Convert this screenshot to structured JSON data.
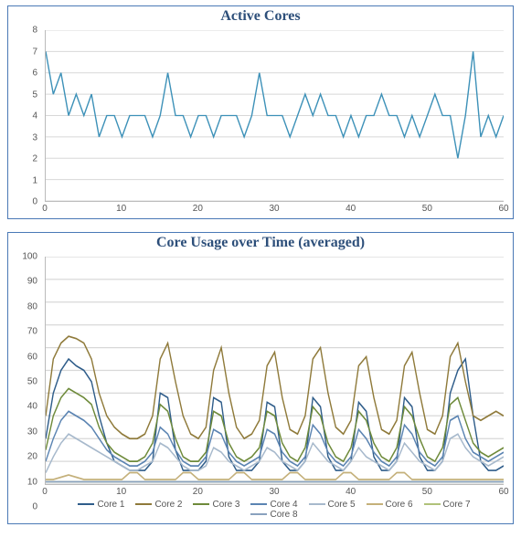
{
  "chart_data": [
    {
      "type": "line",
      "title": "Active Cores",
      "xlabel": "",
      "ylabel": "",
      "xlim": [
        0,
        60
      ],
      "ylim": [
        0,
        8
      ],
      "xticks": [
        0,
        10,
        20,
        30,
        40,
        50,
        60
      ],
      "yticks": [
        0,
        1,
        2,
        3,
        4,
        5,
        6,
        7,
        8
      ],
      "series": [
        {
          "name": "Active Cores",
          "color": "#3d91b8",
          "x": [
            0,
            1,
            2,
            3,
            4,
            5,
            6,
            7,
            8,
            9,
            10,
            11,
            12,
            13,
            14,
            15,
            16,
            17,
            18,
            19,
            20,
            21,
            22,
            23,
            24,
            25,
            26,
            27,
            28,
            29,
            30,
            31,
            32,
            33,
            34,
            35,
            36,
            37,
            38,
            39,
            40,
            41,
            42,
            43,
            44,
            45,
            46,
            47,
            48,
            49,
            50,
            51,
            52,
            53,
            54,
            55,
            56,
            57,
            58,
            59,
            60
          ],
          "values": [
            7,
            5,
            6,
            4,
            5,
            4,
            5,
            3,
            4,
            4,
            3,
            4,
            4,
            4,
            3,
            4,
            6,
            4,
            4,
            3,
            4,
            4,
            3,
            4,
            4,
            4,
            3,
            4,
            6,
            4,
            4,
            4,
            3,
            4,
            5,
            4,
            5,
            4,
            4,
            3,
            4,
            3,
            4,
            4,
            5,
            4,
            4,
            3,
            4,
            3,
            4,
            5,
            4,
            4,
            2,
            4,
            7,
            3,
            4,
            3,
            4
          ]
        }
      ]
    },
    {
      "type": "line",
      "title": "Core Usage over Time (averaged)",
      "xlabel": "",
      "ylabel": "",
      "xlim": [
        0,
        60
      ],
      "ylim": [
        0,
        100
      ],
      "xticks": [
        0,
        10,
        20,
        30,
        40,
        50,
        60
      ],
      "yticks": [
        0,
        10,
        20,
        30,
        40,
        50,
        60,
        70,
        80,
        90,
        100
      ],
      "legend_position": "bottom",
      "series": [
        {
          "name": "Core 1",
          "color": "#2f5d8a",
          "x": [
            0,
            1,
            2,
            3,
            4,
            5,
            6,
            7,
            8,
            9,
            10,
            11,
            12,
            13,
            14,
            15,
            16,
            17,
            18,
            19,
            20,
            21,
            22,
            23,
            24,
            25,
            26,
            27,
            28,
            29,
            30,
            31,
            32,
            33,
            34,
            35,
            36,
            37,
            38,
            39,
            40,
            41,
            42,
            43,
            44,
            45,
            46,
            47,
            48,
            49,
            50,
            51,
            52,
            53,
            54,
            55,
            56,
            57,
            58,
            59,
            60
          ],
          "values": [
            20,
            40,
            50,
            55,
            52,
            50,
            45,
            30,
            18,
            10,
            8,
            6,
            6,
            6,
            10,
            40,
            38,
            15,
            6,
            6,
            6,
            10,
            38,
            36,
            12,
            6,
            6,
            6,
            10,
            36,
            34,
            10,
            6,
            6,
            10,
            38,
            34,
            12,
            6,
            6,
            10,
            36,
            32,
            12,
            6,
            6,
            10,
            38,
            34,
            12,
            6,
            6,
            10,
            40,
            50,
            55,
            30,
            10,
            6,
            6,
            8
          ]
        },
        {
          "name": "Core 2",
          "color": "#8f7a3a",
          "x": [
            0,
            1,
            2,
            3,
            4,
            5,
            6,
            7,
            8,
            9,
            10,
            11,
            12,
            13,
            14,
            15,
            16,
            17,
            18,
            19,
            20,
            21,
            22,
            23,
            24,
            25,
            26,
            27,
            28,
            29,
            30,
            31,
            32,
            33,
            34,
            35,
            36,
            37,
            38,
            39,
            40,
            41,
            42,
            43,
            44,
            45,
            46,
            47,
            48,
            49,
            50,
            51,
            52,
            53,
            54,
            55,
            56,
            57,
            58,
            59,
            60
          ],
          "values": [
            30,
            55,
            62,
            65,
            64,
            62,
            55,
            40,
            30,
            25,
            22,
            20,
            20,
            22,
            30,
            55,
            62,
            45,
            30,
            22,
            20,
            25,
            50,
            60,
            40,
            25,
            20,
            22,
            28,
            52,
            58,
            38,
            24,
            22,
            30,
            55,
            60,
            40,
            25,
            22,
            28,
            52,
            56,
            38,
            24,
            22,
            28,
            52,
            58,
            40,
            24,
            22,
            30,
            56,
            62,
            45,
            30,
            28,
            30,
            32,
            30
          ]
        },
        {
          "name": "Core 3",
          "color": "#6e8a3a",
          "x": [
            0,
            1,
            2,
            3,
            4,
            5,
            6,
            7,
            8,
            9,
            10,
            11,
            12,
            13,
            14,
            15,
            16,
            17,
            18,
            19,
            20,
            21,
            22,
            23,
            24,
            25,
            26,
            27,
            28,
            29,
            30,
            31,
            32,
            33,
            34,
            35,
            36,
            37,
            38,
            39,
            40,
            41,
            42,
            43,
            44,
            45,
            46,
            47,
            48,
            49,
            50,
            51,
            52,
            53,
            54,
            55,
            56,
            57,
            58,
            59,
            60
          ],
          "values": [
            15,
            30,
            38,
            42,
            40,
            38,
            35,
            25,
            18,
            14,
            12,
            10,
            10,
            12,
            18,
            35,
            32,
            20,
            12,
            10,
            10,
            14,
            32,
            30,
            18,
            12,
            10,
            12,
            16,
            32,
            30,
            18,
            12,
            10,
            16,
            34,
            30,
            18,
            12,
            10,
            16,
            32,
            28,
            18,
            12,
            10,
            16,
            34,
            30,
            20,
            12,
            10,
            16,
            35,
            38,
            28,
            18,
            14,
            12,
            14,
            16
          ]
        },
        {
          "name": "Core 4",
          "color": "#5b84b2",
          "x": [
            0,
            1,
            2,
            3,
            4,
            5,
            6,
            7,
            8,
            9,
            10,
            11,
            12,
            13,
            14,
            15,
            16,
            17,
            18,
            19,
            20,
            21,
            22,
            23,
            24,
            25,
            26,
            27,
            28,
            29,
            30,
            31,
            32,
            33,
            34,
            35,
            36,
            37,
            38,
            39,
            40,
            41,
            42,
            43,
            44,
            45,
            46,
            47,
            48,
            49,
            50,
            51,
            52,
            53,
            54,
            55,
            56,
            57,
            58,
            59,
            60
          ],
          "values": [
            10,
            20,
            28,
            32,
            30,
            28,
            25,
            20,
            15,
            12,
            10,
            8,
            8,
            10,
            14,
            25,
            22,
            15,
            10,
            8,
            8,
            12,
            24,
            22,
            14,
            10,
            8,
            10,
            12,
            24,
            22,
            14,
            10,
            8,
            12,
            26,
            22,
            14,
            10,
            8,
            12,
            24,
            20,
            14,
            10,
            8,
            12,
            26,
            22,
            14,
            10,
            8,
            12,
            28,
            30,
            20,
            14,
            12,
            10,
            12,
            14
          ]
        },
        {
          "name": "Core 5",
          "color": "#a7b9cc",
          "x": [
            0,
            1,
            2,
            3,
            4,
            5,
            6,
            7,
            8,
            9,
            10,
            11,
            12,
            13,
            14,
            15,
            16,
            17,
            18,
            19,
            20,
            21,
            22,
            23,
            24,
            25,
            26,
            27,
            28,
            29,
            30,
            31,
            32,
            33,
            34,
            35,
            36,
            37,
            38,
            39,
            40,
            41,
            42,
            43,
            44,
            45,
            46,
            47,
            48,
            49,
            50,
            51,
            52,
            53,
            54,
            55,
            56,
            57,
            58,
            59,
            60
          ],
          "values": [
            5,
            12,
            18,
            22,
            20,
            18,
            16,
            14,
            12,
            10,
            8,
            6,
            6,
            8,
            10,
            18,
            16,
            12,
            8,
            6,
            6,
            8,
            16,
            14,
            10,
            8,
            6,
            8,
            10,
            16,
            14,
            10,
            8,
            6,
            10,
            18,
            14,
            10,
            8,
            6,
            10,
            16,
            12,
            10,
            8,
            6,
            10,
            18,
            14,
            10,
            8,
            6,
            10,
            20,
            22,
            16,
            12,
            10,
            8,
            10,
            12
          ]
        },
        {
          "name": "Core 6",
          "color": "#c4b07a",
          "x": [
            0,
            1,
            2,
            3,
            4,
            5,
            6,
            7,
            8,
            9,
            10,
            11,
            12,
            13,
            14,
            15,
            16,
            17,
            18,
            19,
            20,
            21,
            22,
            23,
            24,
            25,
            26,
            27,
            28,
            29,
            30,
            31,
            32,
            33,
            34,
            35,
            36,
            37,
            38,
            39,
            40,
            41,
            42,
            43,
            44,
            45,
            46,
            47,
            48,
            49,
            50,
            51,
            52,
            53,
            54,
            55,
            56,
            57,
            58,
            59,
            60
          ],
          "values": [
            2,
            2,
            3,
            4,
            3,
            2,
            2,
            2,
            2,
            2,
            2,
            5,
            5,
            2,
            2,
            2,
            2,
            2,
            5,
            5,
            2,
            2,
            2,
            2,
            2,
            5,
            5,
            2,
            2,
            2,
            2,
            2,
            5,
            5,
            2,
            2,
            2,
            2,
            2,
            5,
            5,
            2,
            2,
            2,
            2,
            2,
            5,
            5,
            2,
            2,
            2,
            2,
            2,
            2,
            2,
            2,
            2,
            2,
            2,
            2,
            2
          ]
        },
        {
          "name": "Core 7",
          "color": "#b0c27a",
          "x": [
            0,
            1,
            2,
            3,
            4,
            5,
            6,
            7,
            8,
            9,
            10,
            11,
            12,
            13,
            14,
            15,
            16,
            17,
            18,
            19,
            20,
            21,
            22,
            23,
            24,
            25,
            26,
            27,
            28,
            29,
            30,
            31,
            32,
            33,
            34,
            35,
            36,
            37,
            38,
            39,
            40,
            41,
            42,
            43,
            44,
            45,
            46,
            47,
            48,
            49,
            50,
            51,
            52,
            53,
            54,
            55,
            56,
            57,
            58,
            59,
            60
          ],
          "values": [
            1,
            1,
            1,
            1,
            1,
            1,
            1,
            1,
            1,
            1,
            1,
            1,
            1,
            1,
            1,
            1,
            1,
            1,
            1,
            1,
            1,
            1,
            1,
            1,
            1,
            1,
            1,
            1,
            1,
            1,
            1,
            1,
            1,
            1,
            1,
            1,
            1,
            1,
            1,
            1,
            1,
            1,
            1,
            1,
            1,
            1,
            1,
            1,
            1,
            1,
            1,
            1,
            1,
            1,
            1,
            1,
            1,
            1,
            1,
            1,
            1
          ]
        },
        {
          "name": "Core 8",
          "color": "#8aa2be",
          "x": [
            0,
            1,
            2,
            3,
            4,
            5,
            6,
            7,
            8,
            9,
            10,
            11,
            12,
            13,
            14,
            15,
            16,
            17,
            18,
            19,
            20,
            21,
            22,
            23,
            24,
            25,
            26,
            27,
            28,
            29,
            30,
            31,
            32,
            33,
            34,
            35,
            36,
            37,
            38,
            39,
            40,
            41,
            42,
            43,
            44,
            45,
            46,
            47,
            48,
            49,
            50,
            51,
            52,
            53,
            54,
            55,
            56,
            57,
            58,
            59,
            60
          ],
          "values": [
            1,
            1,
            1,
            1,
            1,
            1,
            1,
            1,
            1,
            1,
            1,
            1,
            1,
            1,
            1,
            1,
            1,
            1,
            1,
            1,
            1,
            1,
            1,
            1,
            1,
            1,
            1,
            1,
            1,
            1,
            1,
            1,
            1,
            1,
            1,
            1,
            1,
            1,
            1,
            1,
            1,
            1,
            1,
            1,
            1,
            1,
            1,
            1,
            1,
            1,
            1,
            1,
            1,
            1,
            1,
            1,
            1,
            1,
            1,
            1,
            1
          ]
        }
      ]
    }
  ]
}
